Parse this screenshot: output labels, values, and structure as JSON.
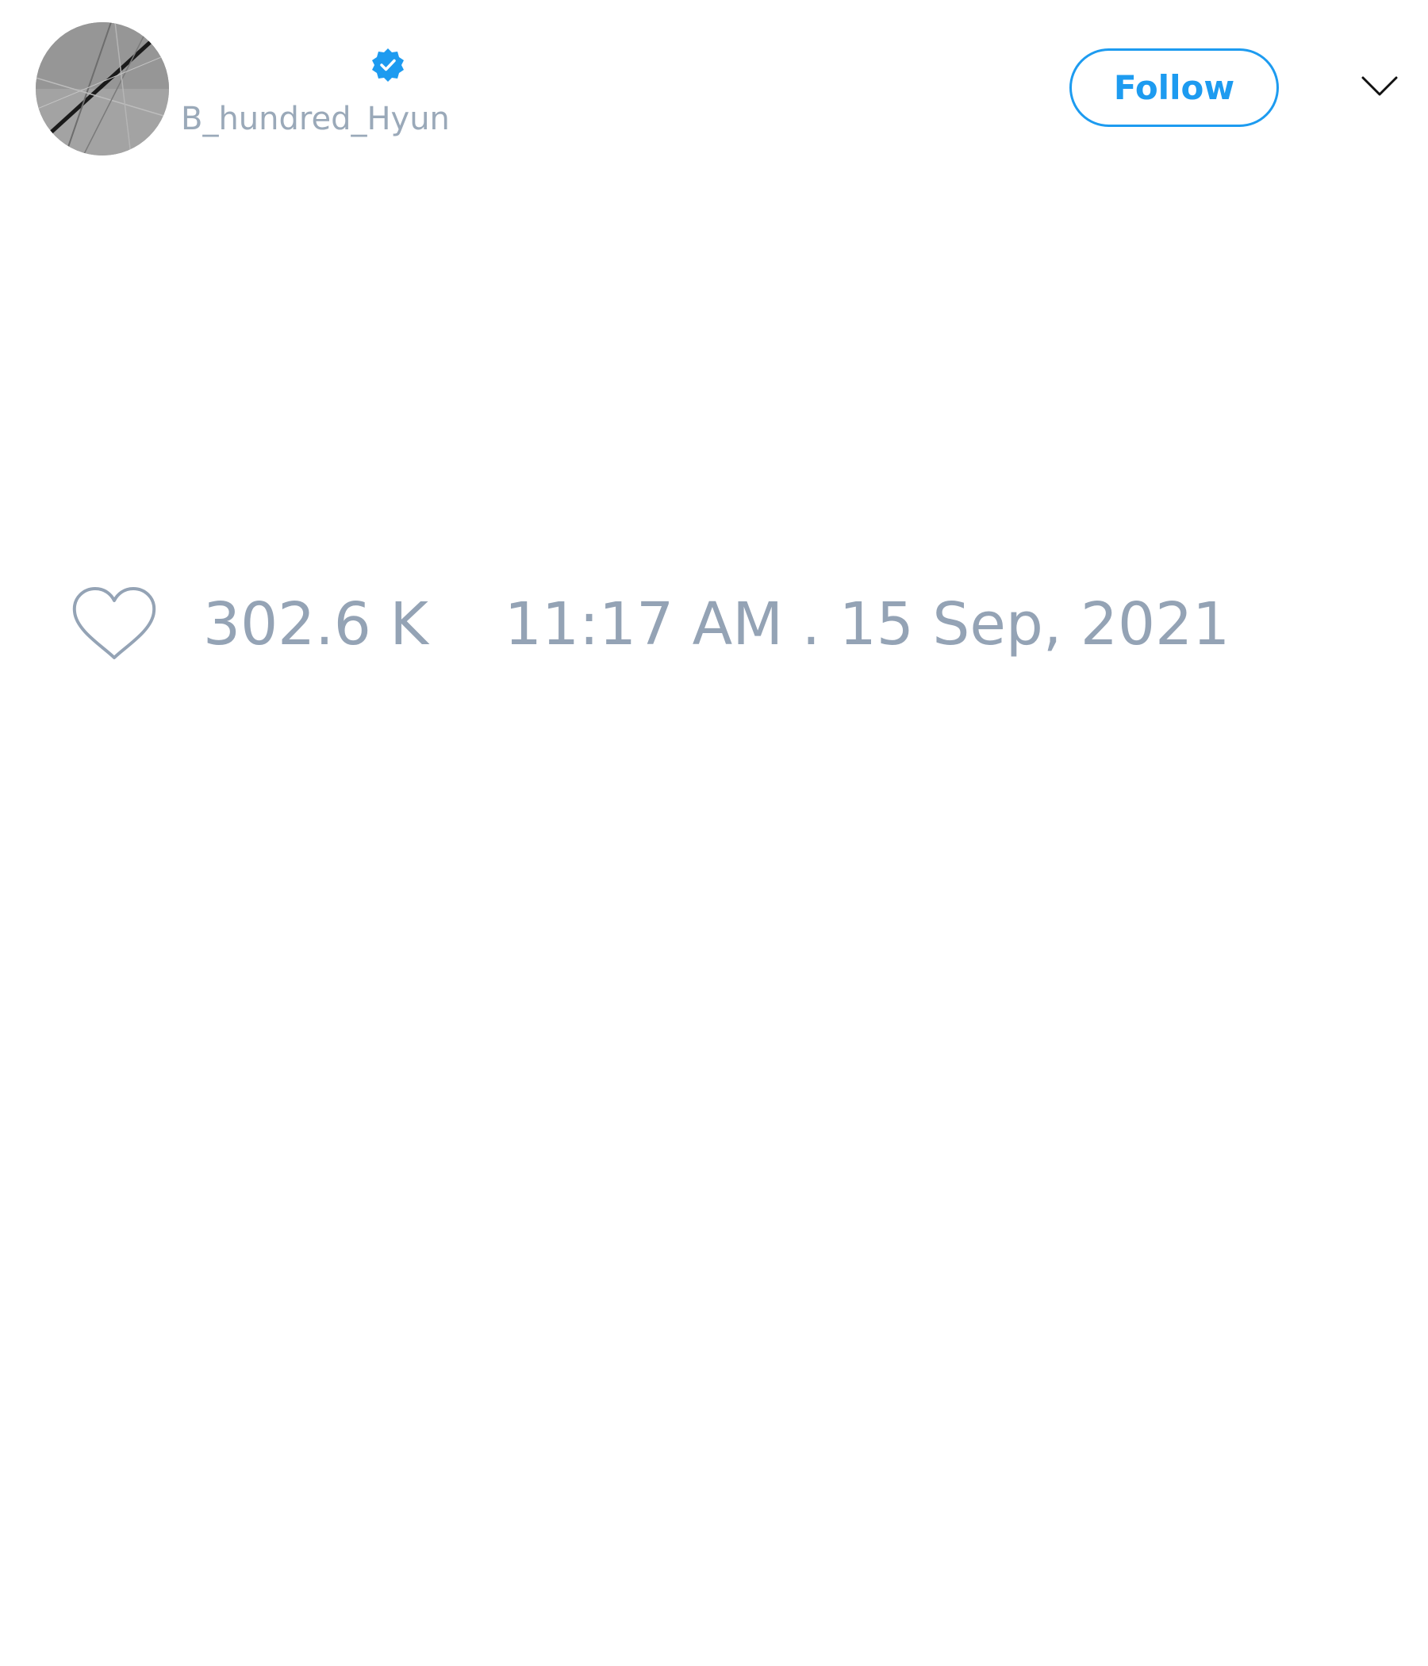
{
  "profile": {
    "display_name": "",
    "handle": "B_hundred_Hyun",
    "verified": true,
    "avatar_icon": "avatar-image",
    "verified_icon": "verified-badge-icon"
  },
  "header": {
    "follow_label": "Follow",
    "menu_icon": "chevron-down-icon"
  },
  "tweet": {
    "like_icon": "heart-icon",
    "like_count": "302.6 K",
    "timestamp": "11:17 AM . 15 Sep, 2021"
  },
  "colors": {
    "accent": "#1d9bf0",
    "muted_text": "#94a3b5",
    "background": "#ffffff"
  }
}
